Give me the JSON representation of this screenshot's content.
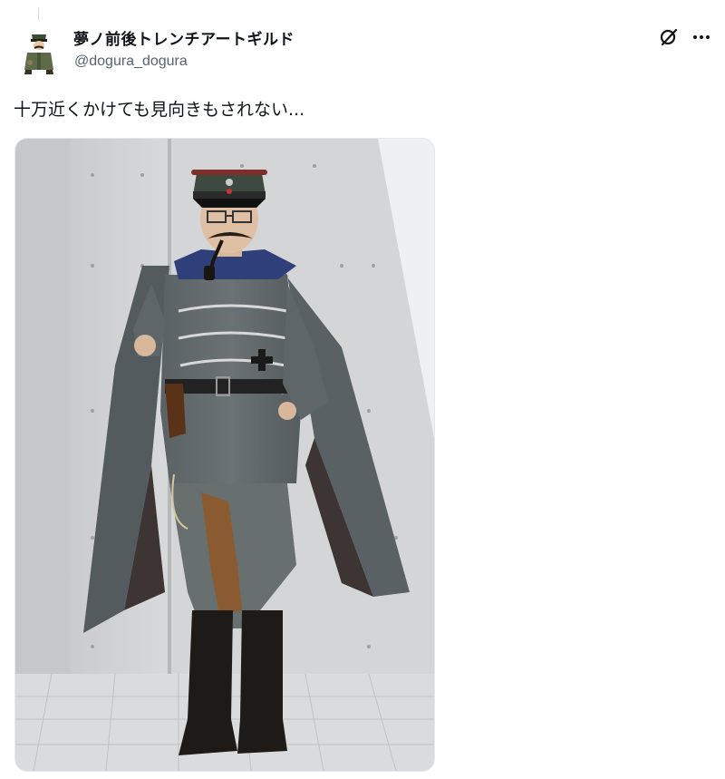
{
  "post": {
    "author": {
      "display_name": "夢ノ前後トレンチアートギルド",
      "handle": "@dogura_dogura"
    },
    "text": "十万近くかけても見向きもされない...",
    "icons": {
      "grok": "grok-slash-circle-icon",
      "more": "more-dots-icon"
    },
    "media": {
      "kind": "photo"
    }
  }
}
